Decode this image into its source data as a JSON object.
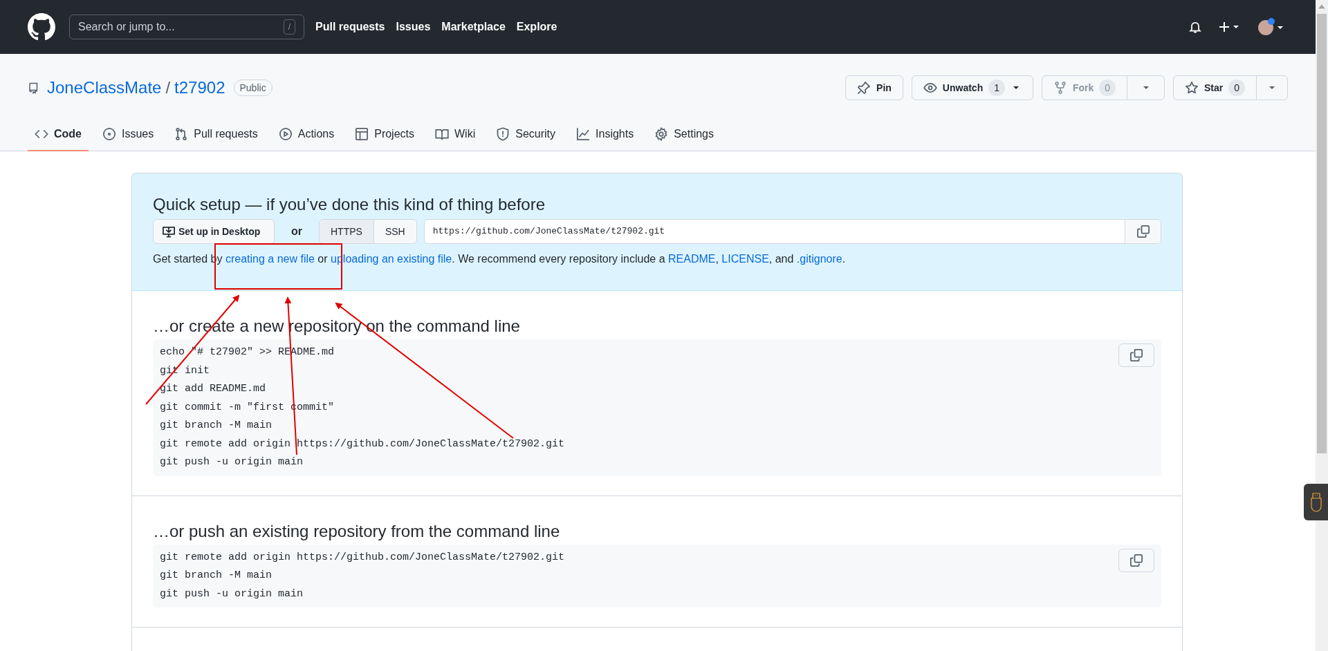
{
  "header": {
    "search_placeholder": "Search or jump to...",
    "search_key": "/",
    "nav": [
      "Pull requests",
      "Issues",
      "Marketplace",
      "Explore"
    ]
  },
  "repo": {
    "owner": "JoneClassMate",
    "separator": "/",
    "name": "t27902",
    "visibility": "Public"
  },
  "repo_actions": [
    {
      "kind": "pin",
      "label": "Pin",
      "disabled": false
    },
    {
      "kind": "watch",
      "label": "Unwatch",
      "count": "1",
      "disabled": false
    },
    {
      "kind": "fork",
      "label": "Fork",
      "count": "0",
      "disabled": true
    },
    {
      "kind": "star",
      "label": "Star",
      "count": "0",
      "disabled": false
    }
  ],
  "tabs": [
    {
      "kind": "code",
      "label": "Code",
      "selected": true
    },
    {
      "kind": "issues",
      "label": "Issues",
      "selected": false
    },
    {
      "kind": "pulls",
      "label": "Pull requests",
      "selected": false
    },
    {
      "kind": "actions",
      "label": "Actions",
      "selected": false
    },
    {
      "kind": "projects",
      "label": "Projects",
      "selected": false
    },
    {
      "kind": "wiki",
      "label": "Wiki",
      "selected": false
    },
    {
      "kind": "security",
      "label": "Security",
      "selected": false
    },
    {
      "kind": "insights",
      "label": "Insights",
      "selected": false
    },
    {
      "kind": "settings",
      "label": "Settings",
      "selected": false
    }
  ],
  "quick_setup": {
    "title": "Quick setup — if you’ve done this kind of thing before",
    "desktop_button": "Set up in Desktop",
    "or": "or",
    "protocols": [
      {
        "label": "HTTPS",
        "selected": true
      },
      {
        "label": "SSH",
        "selected": false
      }
    ],
    "url": "https://github.com/JoneClassMate/t27902.git",
    "intro": [
      {
        "text": "Get started by ",
        "link": false
      },
      {
        "text": "creating a new file",
        "link": true
      },
      {
        "text": " or ",
        "link": false
      },
      {
        "text": "uploading an existing file",
        "link": true
      },
      {
        "text": ". We recommend every repository include a ",
        "link": false
      },
      {
        "text": "README",
        "link": true
      },
      {
        "text": ", ",
        "link": false
      },
      {
        "text": "LICENSE",
        "link": true
      },
      {
        "text": ", and ",
        "link": false
      },
      {
        "text": ".gitignore",
        "link": true
      },
      {
        "text": ".",
        "link": false
      }
    ]
  },
  "sections": [
    {
      "title": "…or create a new repository on the command line",
      "lines": [
        "echo \"# t27902\" >> README.md",
        "git init",
        "git add README.md",
        "git commit -m \"first commit\"",
        "git branch -M main",
        "git remote add origin https://github.com/JoneClassMate/t27902.git",
        "git push -u origin main"
      ]
    },
    {
      "title": "…or push an existing repository from the command line",
      "lines": [
        "git remote add origin https://github.com/JoneClassMate/t27902.git",
        "git branch -M main",
        "git push -u origin main"
      ]
    }
  ]
}
